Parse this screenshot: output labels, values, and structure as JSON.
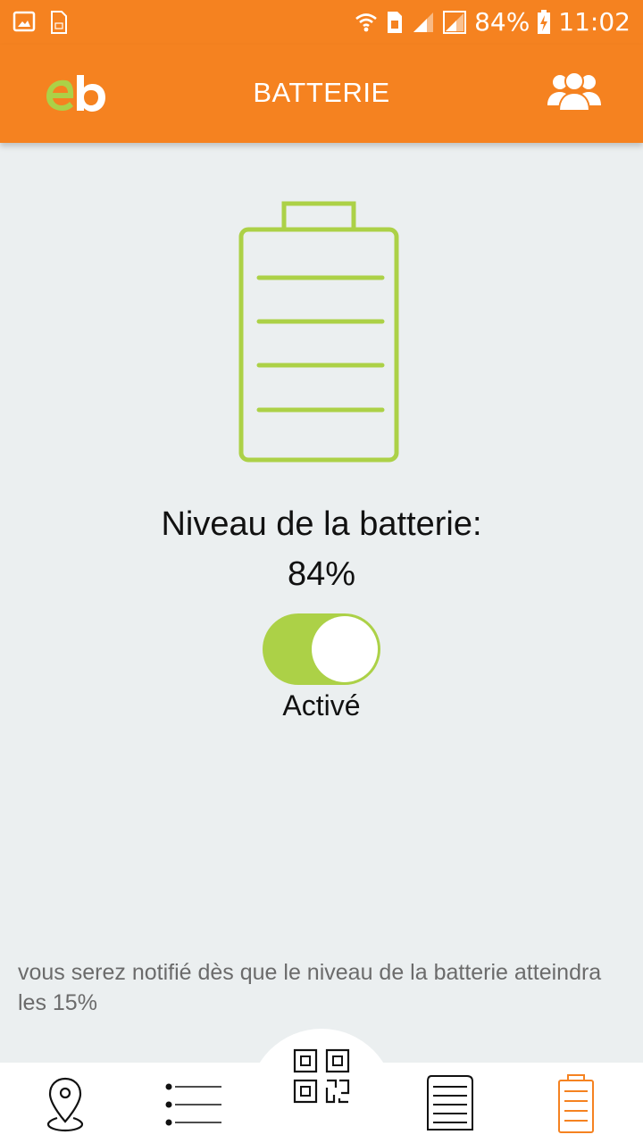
{
  "status_bar": {
    "battery_percent": "84%",
    "time": "11:02"
  },
  "header": {
    "title": "BATTERIE",
    "logo_text": "eb",
    "right_icon": "users-icon"
  },
  "battery": {
    "level_label": "Niveau de la batterie:",
    "level_value": "84%",
    "notification_enabled": true,
    "toggle_state_label": "Activé",
    "notice": "vous serez notifié dès que le niveau de la batterie atteindra les 15%"
  },
  "bottom_nav": {
    "items": [
      {
        "icon": "map-pin-icon"
      },
      {
        "icon": "list-icon"
      },
      {
        "icon": "qr-code-icon"
      },
      {
        "icon": "document-icon"
      },
      {
        "icon": "battery-icon",
        "active": true
      }
    ]
  },
  "colors": {
    "primary": "#f58220",
    "accent_green": "#acd147",
    "background": "#ebeff0",
    "text_dark": "#111111",
    "text_muted": "#6b6b6b"
  }
}
